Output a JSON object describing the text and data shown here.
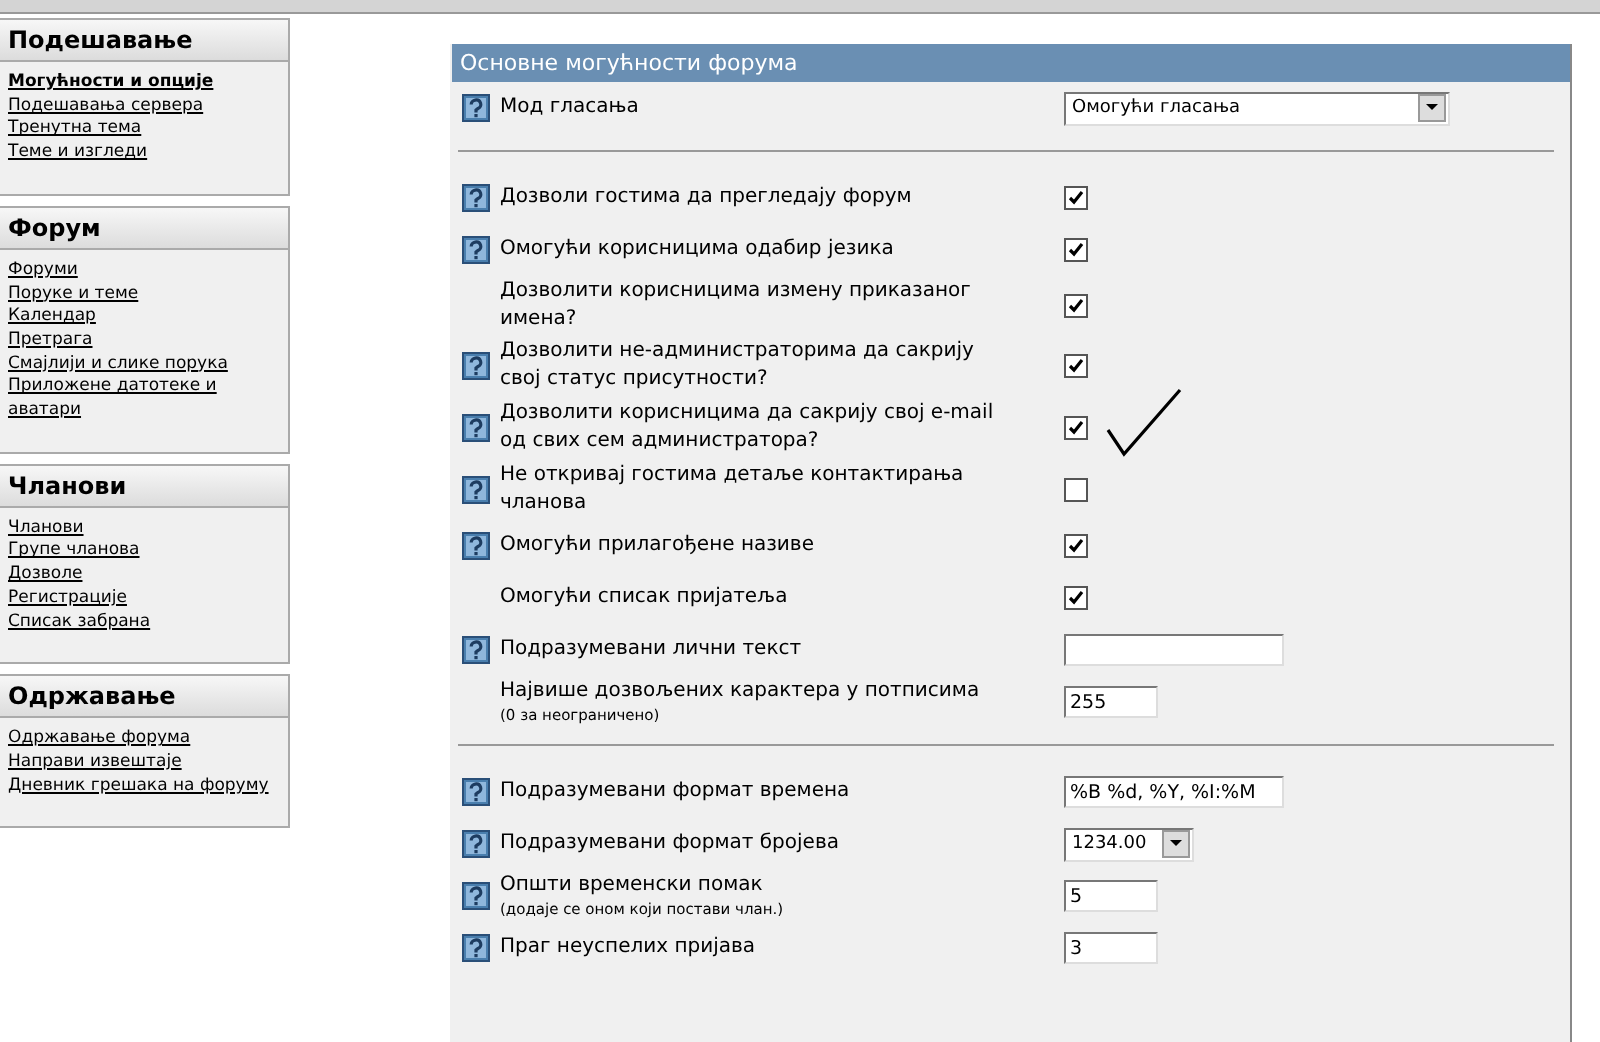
{
  "sidebar": [
    {
      "title": "Подешавање",
      "items": [
        {
          "label": "Могућности и опције",
          "selected": true
        },
        {
          "label": "Подешавања сервера",
          "selected": false
        },
        {
          "label": "Тренутна тема",
          "selected": false
        },
        {
          "label": "Теме и изгледи",
          "selected": false
        }
      ]
    },
    {
      "title": "Форум",
      "items": [
        {
          "label": "Форуми",
          "selected": false
        },
        {
          "label": "Поруке и теме",
          "selected": false
        },
        {
          "label": "Календар",
          "selected": false
        },
        {
          "label": "Претрага",
          "selected": false
        },
        {
          "label": "Смајлији и слике порука",
          "selected": false
        },
        {
          "label": "Приложене датотеке и аватари",
          "selected": false
        }
      ]
    },
    {
      "title": "Чланови",
      "items": [
        {
          "label": "Чланови",
          "selected": false
        },
        {
          "label": "Групе чланова",
          "selected": false
        },
        {
          "label": "Дозволе",
          "selected": false
        },
        {
          "label": "Регистрације",
          "selected": false
        },
        {
          "label": "Списак забрана",
          "selected": false
        }
      ]
    },
    {
      "title": "Одржавање",
      "items": [
        {
          "label": "Одржавање форума",
          "selected": false
        },
        {
          "label": "Направи извештаје",
          "selected": false
        },
        {
          "label": "Дневник грешака на форуму",
          "selected": false
        }
      ]
    }
  ],
  "panel": {
    "title": "Основне могућности форума",
    "rows": [
      {
        "kind": "select",
        "help": true,
        "label": "Мод гласања",
        "value": "Омогући гласања"
      },
      {
        "kind": "separator"
      },
      {
        "kind": "checkbox",
        "help": true,
        "label": "Дозволи гостима да прегледају форум",
        "checked": true
      },
      {
        "kind": "checkbox",
        "help": true,
        "label": "Омогући корисницима одабир језика",
        "checked": true
      },
      {
        "kind": "checkbox",
        "help": false,
        "label": "Дозволити корисницима измену приказаног имена?",
        "checked": true
      },
      {
        "kind": "checkbox",
        "help": true,
        "label": "Дозволити не-администраторима да сакрију свој статус присутности?",
        "checked": true
      },
      {
        "kind": "checkbox",
        "help": true,
        "label": "Дозволити корисницима да сакрију свој e-mail од свих сем администратора?",
        "checked": true,
        "tick_mark": true
      },
      {
        "kind": "checkbox",
        "help": true,
        "label": "Не откривај гостима детаље контактирања чланова",
        "checked": false
      },
      {
        "kind": "checkbox",
        "help": true,
        "label": "Омогући прилагођене називе",
        "checked": true
      },
      {
        "kind": "checkbox",
        "help": false,
        "label": "Омогући списак пријатеља",
        "checked": true
      },
      {
        "kind": "text",
        "help": true,
        "label": "Подразумевани лични текст"
      },
      {
        "kind": "number",
        "help": false,
        "label": "Највише дозвољених карактера у потписима",
        "note": "(0 за неограничено)",
        "value": "255"
      },
      {
        "kind": "separator"
      },
      {
        "kind": "text",
        "help": true,
        "label": "Подразумевани формат времена",
        "value": "%B %d, %Y, %I:%M"
      },
      {
        "kind": "smallselect",
        "help": true,
        "label": "Подразумевани формат бројева",
        "value": "1234.00"
      },
      {
        "kind": "number",
        "help": true,
        "label": "Општи временски помак",
        "note": "(додаје се оном који постави члан.)",
        "value": "5"
      },
      {
        "kind": "number",
        "help": true,
        "label": "Праг неуспелих пријава",
        "value": "3"
      }
    ]
  }
}
